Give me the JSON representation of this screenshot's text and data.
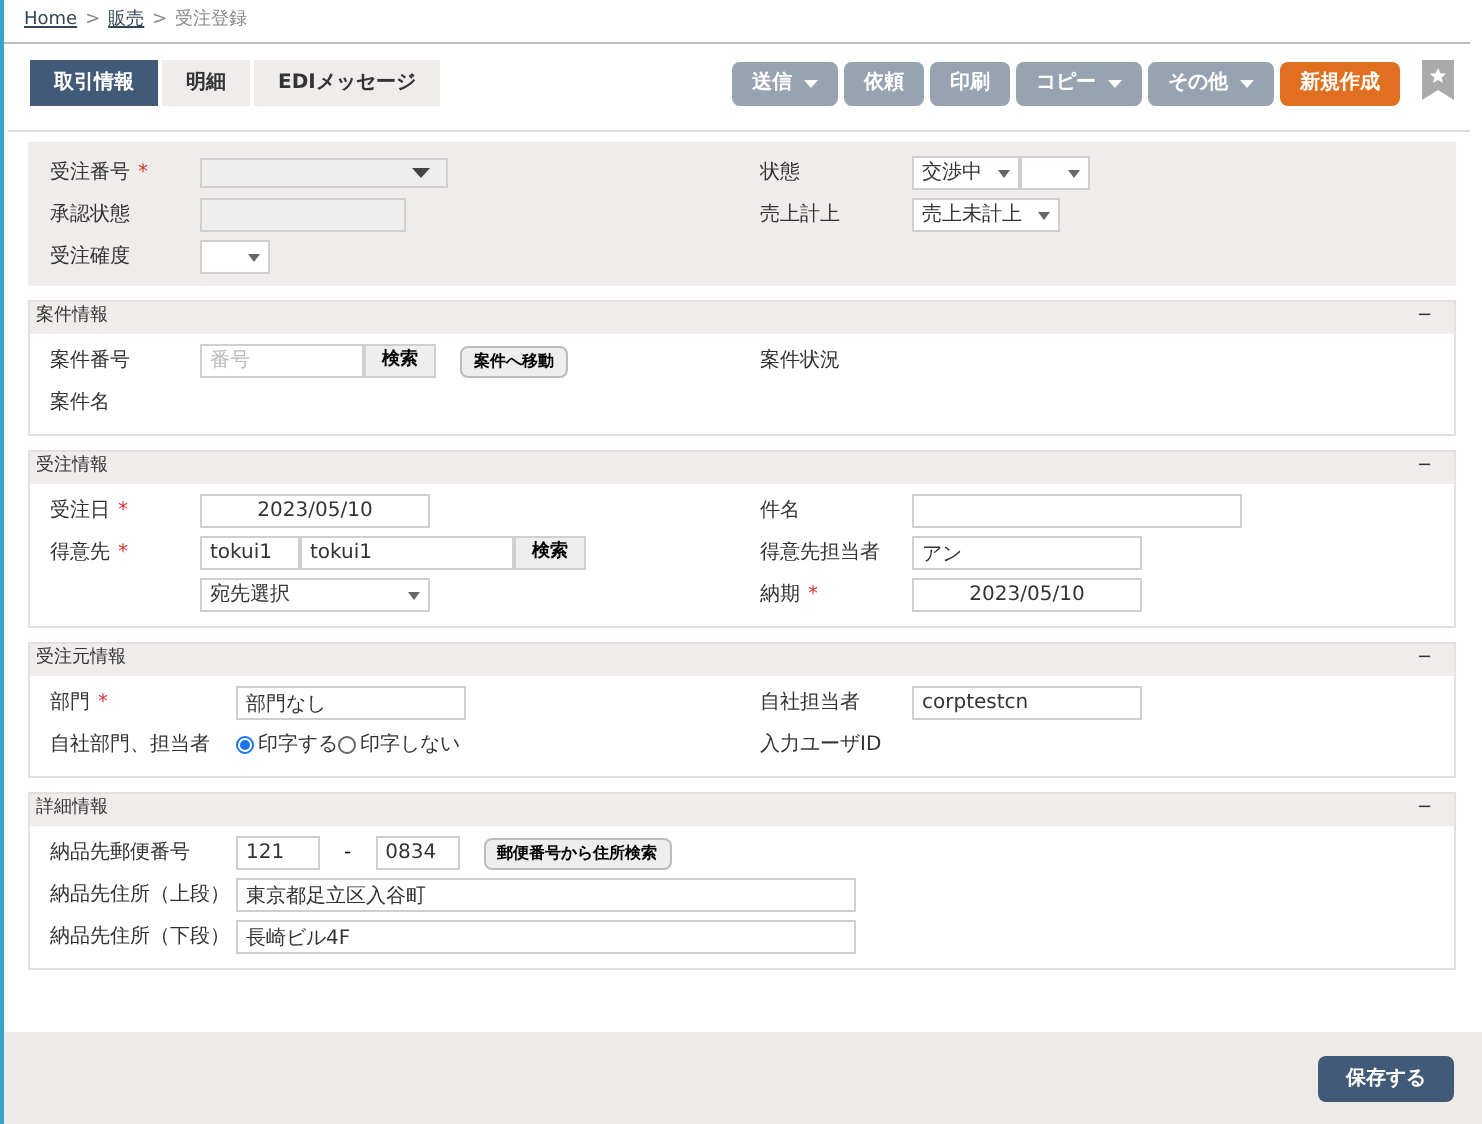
{
  "breadcrumb": [
    {
      "label": "Home",
      "kind": "link"
    },
    {
      "label": "販売",
      "kind": "link"
    },
    {
      "label": "受注登録",
      "kind": "current"
    }
  ],
  "separator": ">",
  "tabs": [
    {
      "label": "取引情報",
      "selected": true
    },
    {
      "label": "明細",
      "selected": false
    },
    {
      "label": "EDIメッセージ",
      "selected": false
    }
  ],
  "toolbar": [
    {
      "label": "送信",
      "kind": "menu",
      "disabled": true
    },
    {
      "label": "依頼",
      "kind": "plain",
      "disabled": true
    },
    {
      "label": "印刷",
      "kind": "plain",
      "disabled": true
    },
    {
      "label": "コピー",
      "kind": "menu",
      "disabled": true
    },
    {
      "label": "その他",
      "kind": "menu",
      "disabled": true
    },
    {
      "label": "新規作成",
      "kind": "primary",
      "disabled": false
    }
  ],
  "header": {
    "rows": [
      {
        "left": {
          "label": "受注番号",
          "required_mark": "*",
          "controls": [
            {
              "kind": "combo"
            }
          ]
        },
        "right": {
          "label": "状態",
          "controls": [
            {
              "kind": "select",
              "value": "交渉中"
            },
            {
              "kind": "select"
            }
          ]
        }
      },
      {
        "left": {
          "label": "承認状態",
          "controls": [
            {
              "kind": "readonly"
            }
          ]
        },
        "right": {
          "label": "売上計上",
          "controls": [
            {
              "kind": "select",
              "value": "売上未計上"
            }
          ]
        }
      },
      {
        "left": {
          "label": "受注確度",
          "controls": [
            {
              "kind": "select"
            }
          ]
        }
      }
    ]
  },
  "sections": [
    {
      "title": "案件情報",
      "toggle": "−",
      "rows": [
        {
          "left": {
            "label": "案件番号",
            "controls": [
              {
                "kind": "lookup",
                "placeholder": "番号",
                "button": "検索"
              },
              {
                "kind": "button",
                "label": "案件へ移動"
              }
            ]
          },
          "right": {
            "label": "案件状況"
          }
        },
        {
          "left": {
            "label": "案件名"
          }
        }
      ]
    },
    {
      "title": "受注情報",
      "toggle": "−",
      "rows": [
        {
          "left": {
            "label": "受注日",
            "required_mark": "*",
            "controls": [
              {
                "kind": "date",
                "value": "2023/05/10"
              }
            ]
          },
          "right": {
            "label": "件名",
            "controls": [
              {
                "kind": "long"
              }
            ]
          }
        },
        {
          "left": {
            "label": "得意先",
            "required_mark": "*",
            "controls": [
              {
                "kind": "pair",
                "value": "tokui1",
                "value2": "tokui1",
                "button": "検索"
              }
            ]
          },
          "right": {
            "label": "得意先担当者",
            "controls": [
              {
                "kind": "input",
                "value": "アン"
              }
            ]
          }
        },
        {
          "left": {
            "controls": [
              {
                "kind": "wide-select",
                "value": "宛先選択"
              }
            ]
          },
          "right": {
            "label": "納期",
            "required_mark": "*",
            "controls": [
              {
                "kind": "date",
                "value": "2023/05/10"
              }
            ]
          }
        }
      ]
    },
    {
      "title": "受注元情報",
      "toggle": "−",
      "rows": [
        {
          "left": {
            "label": "部門",
            "required_mark": "*",
            "controls": [
              {
                "kind": "input",
                "value": "部門なし"
              }
            ]
          },
          "right": {
            "label": "自社担当者",
            "controls": [
              {
                "kind": "input",
                "value": "corptestcn"
              }
            ]
          }
        },
        {
          "left": {
            "label": "自社部門、担当者",
            "controls": [
              {
                "kind": "radio",
                "label": "印字する",
                "selected": true
              },
              {
                "kind": "radio",
                "label": "印字しない",
                "selected": false
              }
            ]
          },
          "right": {
            "label": "入力ユーザID"
          }
        }
      ]
    },
    {
      "title": "詳細情報",
      "toggle": "−",
      "rows": [
        {
          "left": {
            "label": "納品先郵便番号",
            "controls": [
              {
                "kind": "zip",
                "value": "121"
              },
              {
                "kind": "dash",
                "label": "-"
              },
              {
                "kind": "zip",
                "value": "0834"
              },
              {
                "kind": "button",
                "label": "郵便番号から住所検索"
              }
            ]
          }
        },
        {
          "left": {
            "label": "納品先住所（上段）",
            "controls": [
              {
                "kind": "address",
                "value": "東京都足立区入谷町"
              }
            ]
          }
        },
        {
          "left": {
            "label": "納品先住所（下段）",
            "controls": [
              {
                "kind": "address",
                "value": "長崎ビル4F"
              }
            ]
          }
        }
      ]
    }
  ],
  "footer": {
    "save": "保存する"
  }
}
